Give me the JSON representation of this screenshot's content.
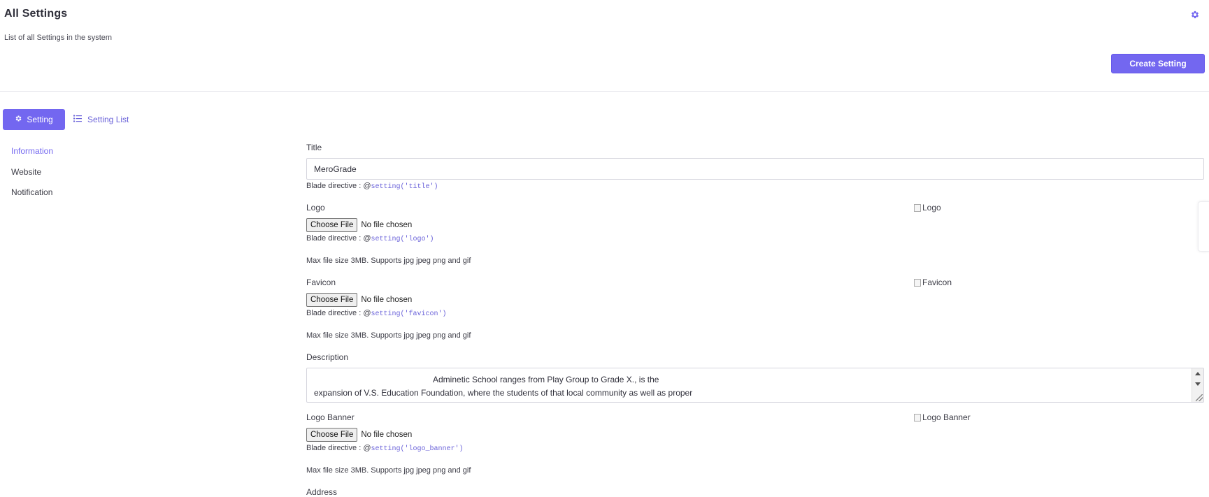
{
  "header": {
    "title": "All Settings",
    "subtitle": "List of all Settings in the system",
    "settings_icon": "gear-icon",
    "create_button": "Create Setting"
  },
  "tabs": [
    {
      "label": "Setting",
      "icon": "gear-icon",
      "active": true
    },
    {
      "label": "Setting List",
      "icon": "list-icon",
      "active": false
    }
  ],
  "sidebar": {
    "items": [
      {
        "label": "Information",
        "active": true
      },
      {
        "label": "Website",
        "active": false
      },
      {
        "label": "Notification",
        "active": false
      }
    ]
  },
  "form": {
    "title": {
      "label": "Title",
      "value": "MeroGrade",
      "directive_prefix": "Blade directive : @",
      "directive_code": "setting('title')"
    },
    "logo": {
      "label": "Logo",
      "button": "Choose File",
      "status": "No file chosen",
      "directive_prefix": "Blade directive : @",
      "directive_code": "setting('logo')",
      "help": "Max file size 3MB. Supports jpg jpeg png and gif",
      "image_alt": "Logo"
    },
    "favicon": {
      "label": "Favicon",
      "button": "Choose File",
      "status": "No file chosen",
      "directive_prefix": "Blade directive : @",
      "directive_code": "setting('favicon')",
      "help": "Max file size 3MB. Supports jpg jpeg png and gif",
      "image_alt": "Favicon"
    },
    "description": {
      "label": "Description",
      "line1": "Adminetic School ranges from Play Group to Grade X., is the",
      "line2": "expansion of V.S. Education Foundation, where the students of that local community as well as proper"
    },
    "logo_banner": {
      "label": "Logo Banner",
      "button": "Choose File",
      "status": "No file chosen",
      "directive_prefix": "Blade directive : @",
      "directive_code": "setting('logo_banner')",
      "help": "Max file size 3MB. Supports jpg jpeg png and gif",
      "image_alt": "Logo Banner"
    },
    "address": {
      "label": "Address"
    }
  },
  "colors": {
    "accent": "#7367f0",
    "text": "#3c3c46"
  }
}
